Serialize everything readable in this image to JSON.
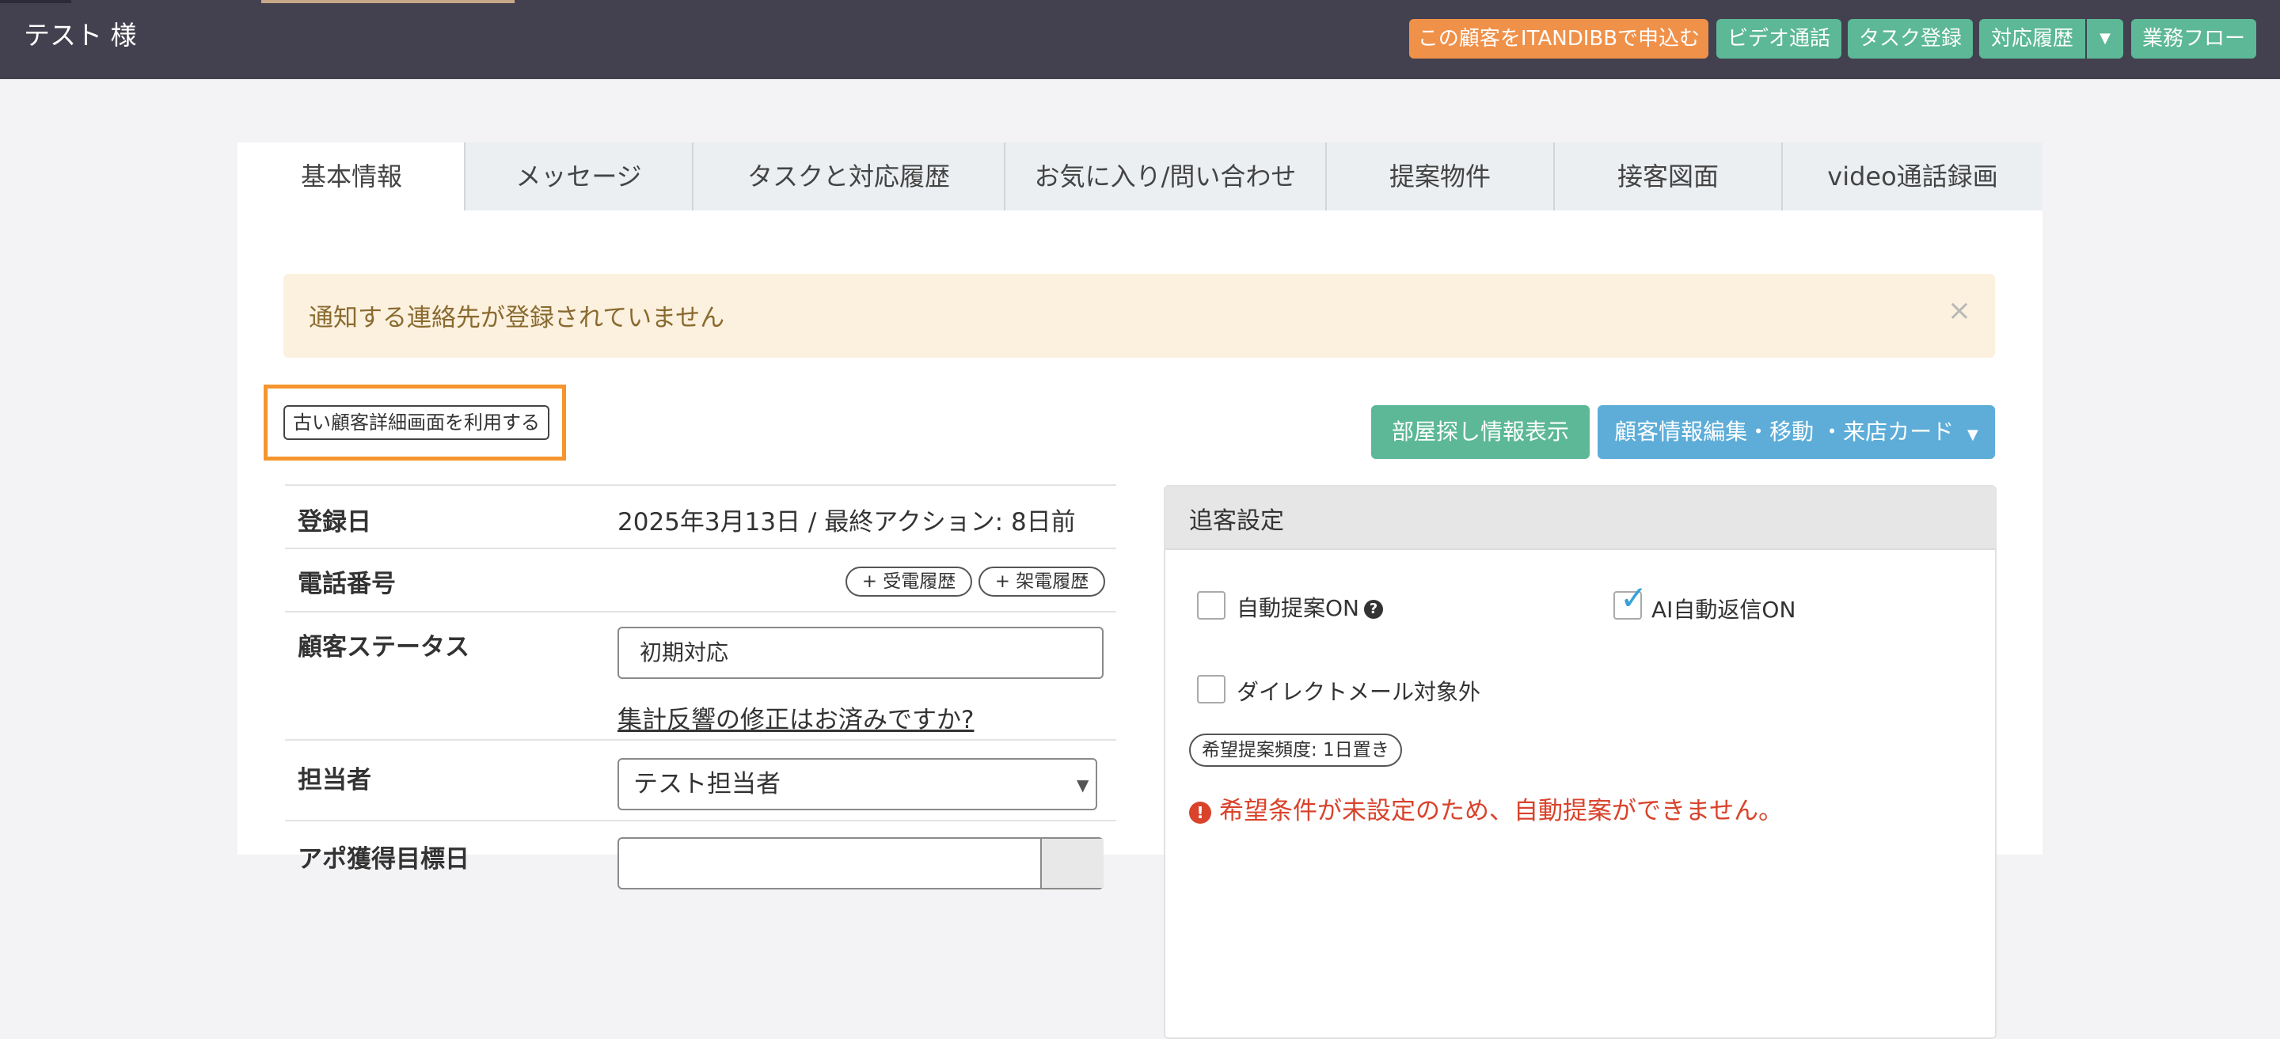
{
  "header": {
    "customer_name": "テスト 様",
    "buttons": {
      "apply_itandi": "この顧客をITANDIBBで申込む",
      "video_call": "ビデオ通話",
      "task_register": "タスク登録",
      "history": "対応履歴",
      "workflow": "業務フロー"
    },
    "colors": {
      "apply_itandi": "#f0914a",
      "green_buttons": "#5cb896",
      "topbar": "#43414f"
    }
  },
  "tabs": [
    {
      "label": "基本情報",
      "active": true
    },
    {
      "label": "メッセージ"
    },
    {
      "label": "タスクと対応履歴"
    },
    {
      "label": "お気に入り/問い合わせ"
    },
    {
      "label": "提案物件"
    },
    {
      "label": "接客図面"
    },
    {
      "label": "video通話録画"
    }
  ],
  "alert": {
    "text": "通知する連絡先が登録されていません",
    "close": "×"
  },
  "actions": {
    "old_ui": "古い顧客詳細画面を利用する",
    "room_search": "部屋探し情報表示",
    "edit_customer": "顧客情報編集・移動 ・来店カード"
  },
  "details": {
    "registered": {
      "label": "登録日",
      "value": "2025年3月13日 / 最終アクション: 8日前"
    },
    "phone": {
      "label": "電話番号",
      "incoming": "+ 受電履歴",
      "outgoing": "+ 架電履歴"
    },
    "status": {
      "label": "顧客ステータス",
      "value": "初期対応",
      "link": "集計反響の修正はお済みですか?"
    },
    "assignee": {
      "label": "担当者",
      "value": "テスト担当者"
    },
    "appointment": {
      "label": "アポ獲得目標日"
    }
  },
  "followup": {
    "title": "追客設定",
    "auto_proposal": {
      "label": "自動提案ON",
      "checked": false
    },
    "ai_reply": {
      "label": "AI自動返信ON",
      "checked": true
    },
    "direct_mail": {
      "label": "ダイレクトメール対象外",
      "checked": false
    },
    "frequency": "希望提案頻度: 1日置き",
    "warning": "希望条件が未設定のため、自動提案ができません。"
  }
}
